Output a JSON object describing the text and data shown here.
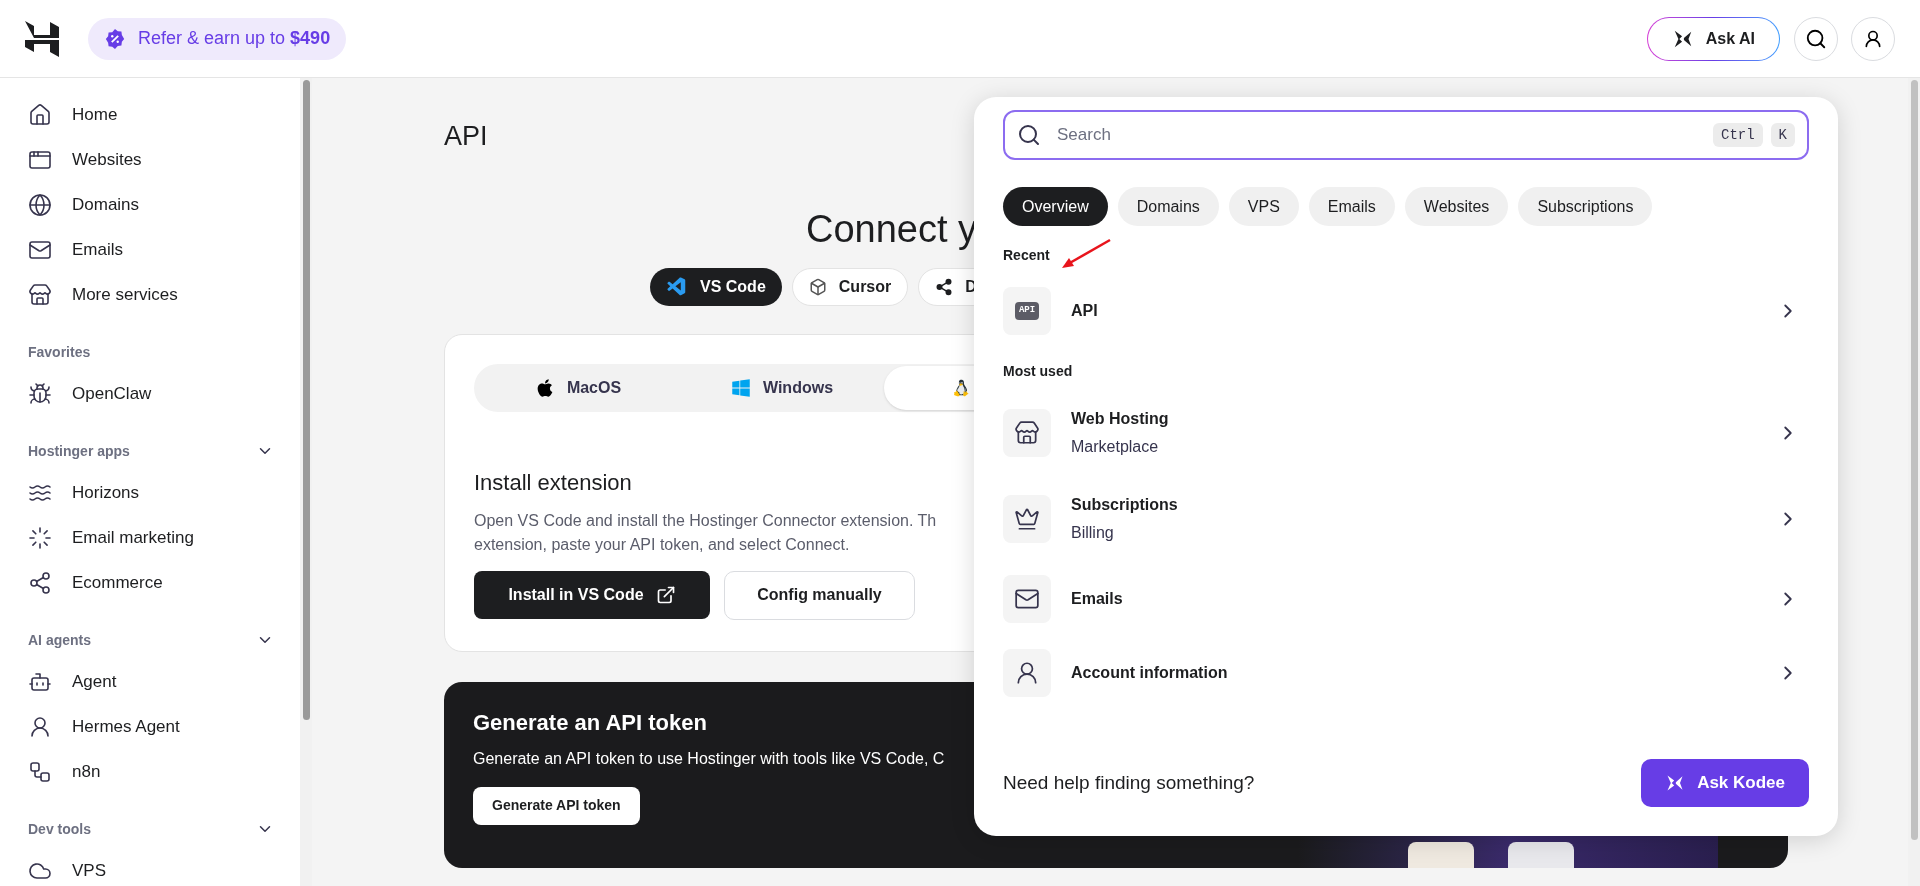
{
  "header": {
    "promo": "Refer & earn up to **$490**",
    "ask_ai": "Ask AI"
  },
  "sidebar": {
    "sections": [
      {
        "items": [
          {
            "label": "Home"
          },
          {
            "label": "Websites"
          },
          {
            "label": "Domains"
          },
          {
            "label": "Emails"
          },
          {
            "label": "More services"
          }
        ]
      },
      {
        "title": "Favorites",
        "items": [
          {
            "label": "OpenClaw"
          }
        ]
      },
      {
        "title": "Hostinger apps",
        "expanded": true,
        "items": [
          {
            "label": "Horizons"
          },
          {
            "label": "Email marketing"
          },
          {
            "label": "Ecommerce"
          }
        ]
      },
      {
        "title": "AI agents",
        "expanded": true,
        "items": [
          {
            "label": "Agent"
          },
          {
            "label": "Hermes Agent"
          },
          {
            "label": "n8n"
          }
        ]
      },
      {
        "title": "Dev tools",
        "expanded": true,
        "items": [
          {
            "label": "VPS"
          }
        ]
      }
    ]
  },
  "page": {
    "title": "API",
    "connect_title": "Connect y",
    "tools": [
      {
        "label": "VS Code",
        "selected": true
      },
      {
        "label": "Cursor",
        "selected": false
      },
      {
        "label": "D",
        "selected": false
      }
    ],
    "os_tabs": [
      {
        "label": "MacOS",
        "selected": false
      },
      {
        "label": "Windows",
        "selected": false
      },
      {
        "selected": true
      }
    ],
    "install": {
      "title": "Install extension",
      "description_lines": [
        "Open VS Code and install the Hostinger Connector extension. Th",
        "extension, paste your API token, and select Connect."
      ],
      "primary_button": "Install in VS Code",
      "secondary_button": "Config manually"
    },
    "token": {
      "title": "Generate an API token",
      "description": "Generate an API token to use Hostinger with tools like VS Code, C",
      "button": "Generate API token"
    }
  },
  "search_panel": {
    "placeholder": "Search",
    "shortcut": [
      "Ctrl",
      "K"
    ],
    "filters": [
      {
        "label": "Overview",
        "selected": true
      },
      {
        "label": "Domains",
        "selected": false
      },
      {
        "label": "VPS",
        "selected": false
      },
      {
        "label": "Emails",
        "selected": false
      },
      {
        "label": "Websites",
        "selected": false
      },
      {
        "label": "Subscriptions",
        "selected": false
      }
    ],
    "sections": [
      {
        "title": "Recent",
        "items": [
          {
            "title": "API",
            "badge": "API"
          }
        ]
      },
      {
        "title": "Most used",
        "items": [
          {
            "title": "Web Hosting",
            "subtitle": "Marketplace"
          },
          {
            "title": "Subscriptions",
            "subtitle": "Billing"
          },
          {
            "title": "Emails"
          },
          {
            "title": "Account information"
          }
        ]
      }
    ],
    "footer": {
      "text": "Need help finding something?",
      "button": "Ask Kodee"
    }
  }
}
